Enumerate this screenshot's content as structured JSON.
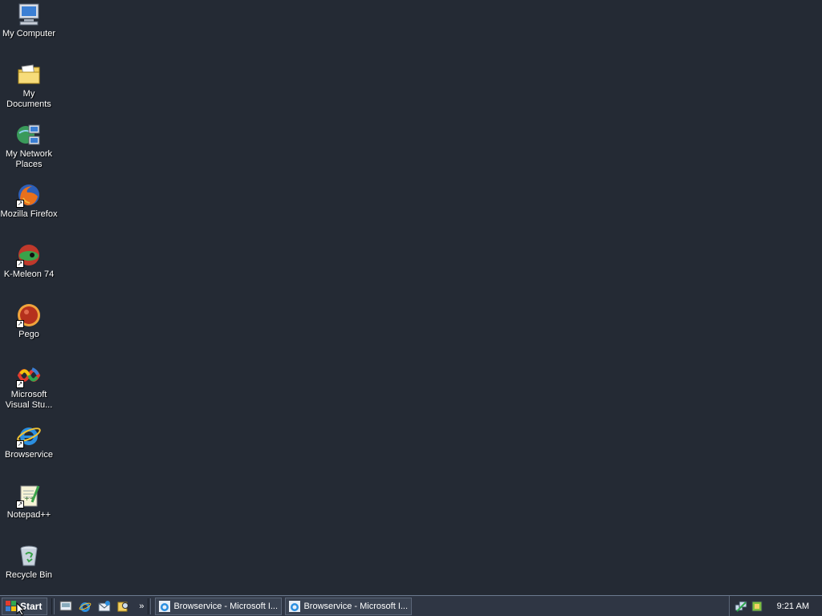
{
  "desktop": {
    "icons": [
      {
        "label": "My Computer",
        "icon": "computer-icon"
      },
      {
        "label": "My Documents",
        "icon": "folder-icon"
      },
      {
        "label": "My Network Places",
        "icon": "network-icon"
      },
      {
        "label": "Mozilla Firefox",
        "icon": "firefox-icon"
      },
      {
        "label": "K-Meleon 74",
        "icon": "kmeleon-icon"
      },
      {
        "label": "Pego",
        "icon": "pego-icon"
      },
      {
        "label": "Microsoft Visual Stu...",
        "icon": "visual-studio-icon"
      },
      {
        "label": "Browservice",
        "icon": "internet-explorer-icon"
      },
      {
        "label": "Notepad++",
        "icon": "notepad-plus-icon"
      },
      {
        "label": "Recycle Bin",
        "icon": "recycle-bin-icon"
      }
    ]
  },
  "taskbar": {
    "start_label": "Start",
    "quick_launch": [
      "show-desktop-icon",
      "internet-explorer-icon",
      "outlook-express-icon",
      "search-icon"
    ],
    "overflow": "»",
    "tasks": [
      {
        "label": "Browservice - Microsoft I..."
      },
      {
        "label": "Browservice - Microsoft I..."
      }
    ],
    "clock": "9:21 AM"
  },
  "colors": {
    "desktop": "#242a34",
    "taskbar": "#2f3644"
  }
}
